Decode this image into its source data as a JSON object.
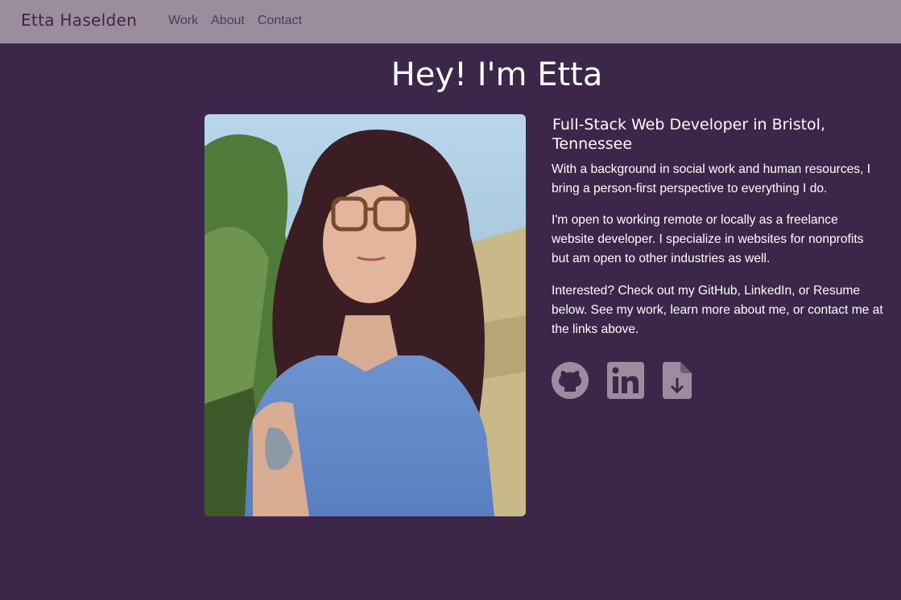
{
  "nav": {
    "brand": "Etta Haselden",
    "links": [
      "Work",
      "About",
      "Contact"
    ]
  },
  "hero": {
    "title": "Hey! I'm Etta",
    "subtitle": "Full-Stack Web Developer in Bristol, Tennessee",
    "paragraphs": [
      "With a background in social work and human resources, I bring a person-first perspective to everything I do.",
      "I'm open to working remote or locally as a freelance website developer. I specialize in websites for nonprofits but am open to other industries as well.",
      "Interested? Check out my GitHub, LinkedIn, or Resume below. See my work, learn more about me, or contact me at the links above."
    ]
  },
  "socials": [
    {
      "icon": "github-icon"
    },
    {
      "icon": "linkedin-icon"
    },
    {
      "icon": "file-download-icon"
    }
  ],
  "colors": {
    "background": "#3c2649",
    "navbar": "#9b8d9e",
    "brand_text": "#3c2649",
    "icon": "#9b8d9e"
  }
}
